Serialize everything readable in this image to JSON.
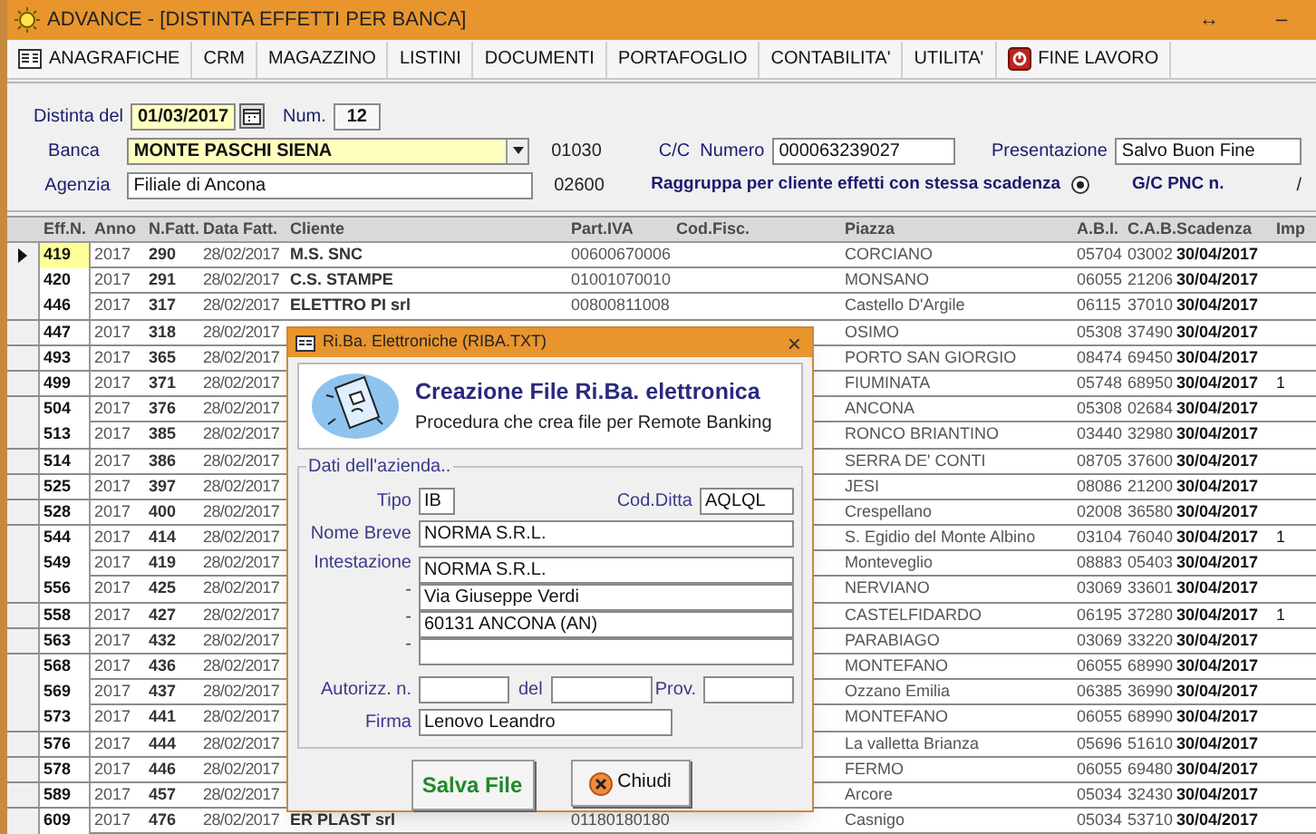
{
  "window": {
    "title": "ADVANCE - [DISTINTA EFFETTI PER BANCA]",
    "controls": [
      "↔",
      "–"
    ]
  },
  "menu": [
    {
      "label": "ANAGRAFICHE",
      "kind": "grid"
    },
    {
      "label": "CRM",
      "kind": "plain"
    },
    {
      "label": "MAGAZZINO",
      "kind": "plain"
    },
    {
      "label": "LISTINI",
      "kind": "plain"
    },
    {
      "label": "DOCUMENTI",
      "kind": "plain"
    },
    {
      "label": "PORTAFOGLIO",
      "kind": "plain"
    },
    {
      "label": "CONTABILITA'",
      "kind": "plain"
    },
    {
      "label": "UTILITA'",
      "kind": "plain"
    },
    {
      "label": "FINE LAVORO",
      "kind": "exit"
    }
  ],
  "form": {
    "distinta_label": "Distinta del",
    "distinta_date": "01/03/2017",
    "num_label": "Num.",
    "num": "12",
    "banca_label": "Banca",
    "banca": "MONTE PASCHI SIENA",
    "abi": "01030",
    "cc_label": "C/C  Numero",
    "cc": "000063239027",
    "presentazione_label": "Presentazione",
    "presentazione": "Salvo Buon Fine",
    "agenzia_label": "Agenzia",
    "agenzia": "Filiale di Ancona",
    "cab": "02600",
    "raggruppa_label": "Raggruppa per cliente effetti con stessa scadenza",
    "raggruppa_checked": true,
    "gc_label": "G/C PNC n.",
    "gc": "/"
  },
  "table": {
    "columns": [
      "Eff.N.",
      "Anno",
      "N.Fatt.",
      "Data Fatt.",
      "Cliente",
      "Part.IVA",
      "Cod.Fisc.",
      "Piazza",
      "A.B.I.",
      "C.A.B.",
      "Scadenza",
      "Imp"
    ],
    "rows": [
      {
        "selected": true,
        "effn": "419",
        "anno": "2017",
        "nfatt": "290",
        "data": "28/02/2017",
        "cliente": "M.S. SNC",
        "piva": "00600670006",
        "piazza": "CORCIANO",
        "abi": "05704",
        "cab": "03002",
        "scadenza": "30/04/2017"
      },
      {
        "selected": false,
        "effn": "420",
        "anno": "2017",
        "nfatt": "291",
        "data": "28/02/2017",
        "cliente": "C.S. STAMPE",
        "piva": "01001070010",
        "piazza": "MONSANO",
        "abi": "06055",
        "cab": "21206",
        "scadenza": "30/04/2017"
      },
      {
        "selected": false,
        "effn": "446",
        "anno": "2017",
        "nfatt": "317",
        "data": "28/02/2017",
        "cliente": "ELETTRO PI srl",
        "piva": "00800811008",
        "piazza": "Castello D'Argile",
        "abi": "06115",
        "cab": "37010",
        "scadenza": "30/04/2017"
      },
      {
        "selected": false,
        "effn": "447",
        "anno": "2017",
        "nfatt": "318",
        "data": "28/02/2017",
        "piazza": "OSIMO",
        "abi": "05308",
        "cab": "37490",
        "scadenza": "30/04/2017"
      },
      {
        "selected": false,
        "effn": "493",
        "anno": "2017",
        "nfatt": "365",
        "data": "28/02/2017",
        "piazza": "PORTO SAN GIORGIO",
        "abi": "08474",
        "cab": "69450",
        "scadenza": "30/04/2017"
      },
      {
        "selected": false,
        "effn": "499",
        "anno": "2017",
        "nfatt": "371",
        "data": "28/02/2017",
        "piazza": "FIUMINATA",
        "abi": "05748",
        "cab": "68950",
        "scadenza": "30/04/2017",
        "imp": "1"
      },
      {
        "selected": false,
        "effn": "504",
        "anno": "2017",
        "nfatt": "376",
        "data": "28/02/2017",
        "piazza": "ANCONA",
        "abi": "05308",
        "cab": "02684",
        "scadenza": "30/04/2017"
      },
      {
        "selected": false,
        "effn": "513",
        "anno": "2017",
        "nfatt": "385",
        "data": "28/02/2017",
        "piazza": "RONCO BRIANTINO",
        "abi": "03440",
        "cab": "32980",
        "scadenza": "30/04/2017"
      },
      {
        "selected": false,
        "effn": "514",
        "anno": "2017",
        "nfatt": "386",
        "data": "28/02/2017",
        "piazza": "SERRA DE' CONTI",
        "abi": "08705",
        "cab": "37600",
        "scadenza": "30/04/2017"
      },
      {
        "selected": false,
        "effn": "525",
        "anno": "2017",
        "nfatt": "397",
        "data": "28/02/2017",
        "piazza": "JESI",
        "abi": "08086",
        "cab": "21200",
        "scadenza": "30/04/2017"
      },
      {
        "selected": false,
        "effn": "528",
        "anno": "2017",
        "nfatt": "400",
        "data": "28/02/2017",
        "piazza": "Crespellano",
        "abi": "02008",
        "cab": "36580",
        "scadenza": "30/04/2017"
      },
      {
        "selected": false,
        "effn": "544",
        "anno": "2017",
        "nfatt": "414",
        "data": "28/02/2017",
        "piazza": "S. Egidio del Monte Albino",
        "abi": "03104",
        "cab": "76040",
        "scadenza": "30/04/2017",
        "imp": "1"
      },
      {
        "selected": false,
        "effn": "549",
        "anno": "2017",
        "nfatt": "419",
        "data": "28/02/2017",
        "piazza": "Monteveglio",
        "abi": "08883",
        "cab": "05403",
        "scadenza": "30/04/2017"
      },
      {
        "selected": false,
        "effn": "556",
        "anno": "2017",
        "nfatt": "425",
        "data": "28/02/2017",
        "piazza": "NERVIANO",
        "abi": "03069",
        "cab": "33601",
        "scadenza": "30/04/2017"
      },
      {
        "selected": false,
        "effn": "558",
        "anno": "2017",
        "nfatt": "427",
        "data": "28/02/2017",
        "piazza": "CASTELFIDARDO",
        "abi": "06195",
        "cab": "37280",
        "scadenza": "30/04/2017",
        "imp": "1"
      },
      {
        "selected": false,
        "effn": "563",
        "anno": "2017",
        "nfatt": "432",
        "data": "28/02/2017",
        "piazza": "PARABIAGO",
        "abi": "03069",
        "cab": "33220",
        "scadenza": "30/04/2017"
      },
      {
        "selected": false,
        "effn": "568",
        "anno": "2017",
        "nfatt": "436",
        "data": "28/02/2017",
        "piazza": "MONTEFANO",
        "abi": "06055",
        "cab": "68990",
        "scadenza": "30/04/2017"
      },
      {
        "selected": false,
        "effn": "569",
        "anno": "2017",
        "nfatt": "437",
        "data": "28/02/2017",
        "piazza": "Ozzano Emilia",
        "abi": "06385",
        "cab": "36990",
        "scadenza": "30/04/2017"
      },
      {
        "selected": false,
        "effn": "573",
        "anno": "2017",
        "nfatt": "441",
        "data": "28/02/2017",
        "piazza": "MONTEFANO",
        "abi": "06055",
        "cab": "68990",
        "scadenza": "30/04/2017"
      },
      {
        "selected": false,
        "effn": "576",
        "anno": "2017",
        "nfatt": "444",
        "data": "28/02/2017",
        "piazza": "La valletta Brianza",
        "abi": "05696",
        "cab": "51610",
        "scadenza": "30/04/2017"
      },
      {
        "selected": false,
        "effn": "578",
        "anno": "2017",
        "nfatt": "446",
        "data": "28/02/2017",
        "piazza": "FERMO",
        "abi": "06055",
        "cab": "69480",
        "scadenza": "30/04/2017"
      },
      {
        "selected": false,
        "effn": "589",
        "anno": "2017",
        "nfatt": "457",
        "data": "28/02/2017",
        "piazza": "Arcore",
        "abi": "05034",
        "cab": "32430",
        "scadenza": "30/04/2017"
      },
      {
        "selected": false,
        "effn": "609",
        "anno": "2017",
        "nfatt": "476",
        "data": "28/02/2017",
        "cliente": "ER PLAST srl",
        "piva": "01180180180",
        "piazza": "Casnigo",
        "abi": "05034",
        "cab": "53710",
        "scadenza": "30/04/2017"
      }
    ]
  },
  "dialog": {
    "title": "Ri.Ba. Elettroniche (RIBA.TXT)",
    "close": "×",
    "heading": "Creazione File Ri.Ba. elettronica",
    "subheading": "Procedura che crea file per Remote Banking",
    "group_label": "Dati dell'azienda..",
    "tipo_label": "Tipo",
    "tipo": "IB",
    "cod_ditta_label": "Cod.Ditta",
    "cod_ditta": "AQLQL",
    "nome_breve_label": "Nome Breve",
    "nome_breve": "NORMA S.R.L.",
    "intestazione": [
      {
        "label": "Intestazione",
        "value": "NORMA S.R.L."
      },
      {
        "label": "-",
        "value": "Via Giuseppe Verdi"
      },
      {
        "label": "-",
        "value": "60131 ANCONA (AN)"
      },
      {
        "label": "-"
      }
    ],
    "autorizz_label": "Autorizz. n.",
    "del_label": "del",
    "prov_label": "Prov.",
    "firma_label": "Firma",
    "firma": "Lenovo Leandro",
    "buttons": [
      {
        "label": "Salva File",
        "kind": "save"
      },
      {
        "label": "Chiudi",
        "kind": "close"
      }
    ]
  }
}
